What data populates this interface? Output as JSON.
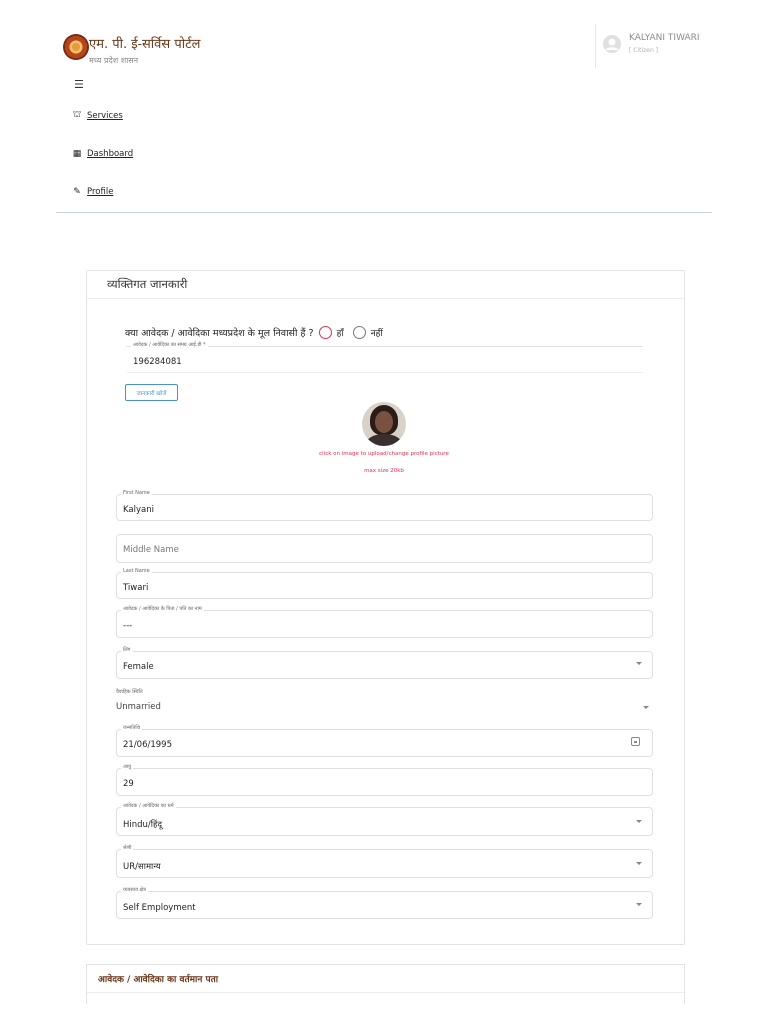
{
  "header": {
    "title": "एम. पी. ई-सर्विस पोर्टल",
    "subtitle": "मध्य प्रदेश शासन",
    "user_name": "KALYANI TIWARI",
    "user_role": "[ Citizen ]"
  },
  "nav": {
    "items": [
      {
        "label": "Services",
        "icon": "sitemap-icon"
      },
      {
        "label": "Dashboard",
        "icon": "dashboard-icon"
      },
      {
        "label": "Profile",
        "icon": "user-edit-icon"
      }
    ]
  },
  "form": {
    "section_title": "व्यक्तिगत जानकारी",
    "native_question": "क्या आवेदक / आवेदिका मध्यप्रदेश के मूल निवासी हैं ?",
    "yes_label": "हाँ",
    "no_label": "नहीं",
    "samagra_label": "आवेदक / आवेदिका का समग्र आई.डी",
    "samagra_required": "*",
    "samagra_value": "196284081",
    "fetch_button": "जानकारी खोजें",
    "upload_note": "click on image to upload/change profile picture",
    "max_size": "max size 20kb",
    "first_name_label": "First Name",
    "first_name_value": "Kalyani",
    "middle_name_placeholder": "Middle Name",
    "last_name_label": "Last Name",
    "last_name_value": "Tiwari",
    "father_label": "आवेदक / आवेदिका के पिता / पति का नाम",
    "father_value": "---",
    "gender_label": "लिंग",
    "gender_value": "Female",
    "marital_label": "वैवाहिक स्थिति",
    "marital_value": "Unmarried",
    "dob_label": "जन्मतिथि",
    "dob_value": "21/06/1995",
    "age_label": "आयु",
    "age_value": "29",
    "religion_label": "आवेदक / आवेदिका का धर्म",
    "religion_value": "Hindu/हिंदू",
    "category_label": "श्रेणी",
    "category_value": "UR/सामान्य",
    "occupation_label": "व्यवसाय क्षेत्र",
    "occupation_value": "Self Employment"
  },
  "address": {
    "section_title": "आवेदक / आवेदिका का वर्तमान पता"
  },
  "colors": {
    "accent_red": "#e5304a",
    "link_blue": "#4a90d9",
    "brand_brown": "#6b3a1e"
  }
}
